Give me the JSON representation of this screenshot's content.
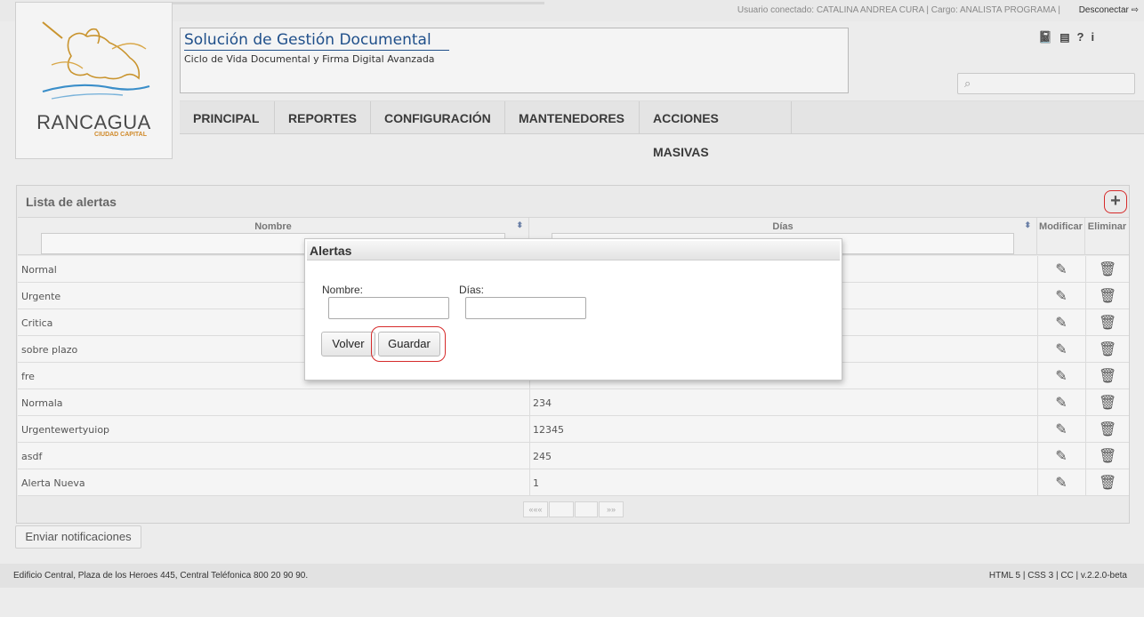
{
  "topbar": {
    "user_info": "Usuario conectado: CATALINA ANDREA CURA | Cargo: ANALISTA PROGRAMA |",
    "disconnect": "Desconectar ⇨"
  },
  "logo": {
    "brand": "RANCAGUA",
    "subbrand": "CIUDAD CAPITAL"
  },
  "header": {
    "title": "Solución de Gestión Documental",
    "subtitle": "Ciclo de Vida Documental y Firma Digital Avanzada",
    "icons": [
      "book-icon",
      "catalog-icon",
      "help-icon",
      "info-icon"
    ]
  },
  "nav": {
    "items": [
      "PRINCIPAL",
      "REPORTES",
      "CONFIGURACIÓN",
      "MANTENEDORES",
      "ACCIONES MASIVAS"
    ]
  },
  "panel": {
    "title": "Lista de alertas",
    "add_label": "+",
    "columns": {
      "nombre": "Nombre",
      "dias": "Días",
      "modificar": "Modificar",
      "eliminar": "Eliminar"
    },
    "rows": [
      {
        "nombre": "Normal",
        "dias": ""
      },
      {
        "nombre": "Urgente",
        "dias": ""
      },
      {
        "nombre": "Critica",
        "dias": ""
      },
      {
        "nombre": "sobre plazo",
        "dias": ""
      },
      {
        "nombre": "fre",
        "dias": ""
      },
      {
        "nombre": "Normala",
        "dias": "234"
      },
      {
        "nombre": "Urgentewertyuiop",
        "dias": "12345"
      },
      {
        "nombre": "asdf",
        "dias": "245"
      },
      {
        "nombre": "Alerta Nueva",
        "dias": "1"
      }
    ],
    "pager": {
      "first": "«««",
      "last": "»»"
    }
  },
  "notify_button": "Enviar notificaciones",
  "footer": {
    "left": "Edificio Central, Plaza de los Heroes 445, Central Teléfonica 800 20 90 90.",
    "right": "HTML 5 | CSS 3 | CC | v.2.2.0-beta"
  },
  "dialog": {
    "title": "Alertas",
    "nombre_label": "Nombre:",
    "dias_label": "Días:",
    "nombre_value": "",
    "dias_value": "",
    "back_button": "Volver",
    "save_button": "Guardar"
  },
  "colors": {
    "highlight": "#d62a2a",
    "title_blue": "#1f4f8a"
  }
}
